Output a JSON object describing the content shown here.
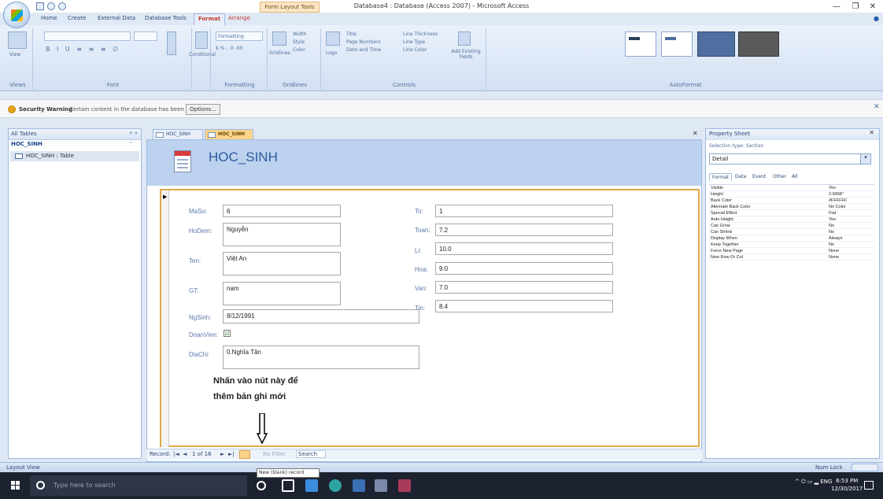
{
  "titlebar": {
    "context_tab": "Form Layout Tools",
    "title": "Database4 : Database (Access 2007) - Microsoft Access",
    "minimize": "—",
    "restore": "❐",
    "close": "✕"
  },
  "ribbon": {
    "tabs": [
      "Home",
      "Create",
      "External Data",
      "Database Tools",
      "Format",
      "Arrange"
    ],
    "active_tab": "Format",
    "groups": {
      "views": "Views",
      "view_button": "View",
      "font": "Font",
      "conditional": "Conditional",
      "formatting": "Formatting",
      "formatting_value": "Formatting",
      "gridlines": "Gridlines",
      "gridlines_btn": "Gridlines",
      "width": "Width",
      "style": "Style",
      "color": "Color",
      "controls": "Controls",
      "logo": "Logo",
      "title": "Title",
      "page_numbers": "Page Numbers",
      "date_time": "Date and Time",
      "line_thickness": "Line Thickness",
      "line_type": "Line Type",
      "line_color": "Line Color",
      "add_existing_fields": "Add Existing Fields",
      "autoformat": "AutoFormat"
    }
  },
  "security": {
    "title": "Security Warning",
    "message": "Certain content in the database has been disabled",
    "options_button": "Options..."
  },
  "navpane": {
    "header": "All Tables",
    "controls": "« »",
    "group": "HOC_SINH",
    "item": "HOC_SINH : Table"
  },
  "document": {
    "tabs": [
      "HOC_SINH",
      "HOC_SINH"
    ],
    "close": "✕"
  },
  "form": {
    "title": "HOC_SINH",
    "fields_left": [
      {
        "label": "MaSo:",
        "value": "6"
      },
      {
        "label": "HoDem:",
        "value": "Nguyễn"
      },
      {
        "label": "Ten:",
        "value": "Việt An"
      },
      {
        "label": "GT:",
        "value": "nam"
      },
      {
        "label": "NgSinh:",
        "value": "8/12/1991"
      },
      {
        "label": "DoanVien:",
        "value": "☑"
      },
      {
        "label": "DiaChi:",
        "value": "0.Nghĩa Tân"
      }
    ],
    "fields_right": [
      {
        "label": "To:",
        "value": "1"
      },
      {
        "label": "Toan:",
        "value": "7.2"
      },
      {
        "label": "Li:",
        "value": "10.0"
      },
      {
        "label": "Hoa:",
        "value": "9.0"
      },
      {
        "label": "Van:",
        "value": "7.0"
      },
      {
        "label": "Tin:",
        "value": "8.4"
      }
    ]
  },
  "annotation": {
    "line1": "Nhấn vào nút này để",
    "line2": "thêm bản ghi mới"
  },
  "record_nav": {
    "record_label": "Record:",
    "first": "|◄",
    "prev": "◄",
    "position": "1 of 16",
    "next": "►",
    "last": "►|",
    "filter": "No Filter",
    "search": "Search",
    "tooltip": "New (blank) record"
  },
  "property_sheet": {
    "title": "Property Sheet",
    "selection_type": "Selection type: Section",
    "selected": "Detail",
    "tabs": [
      "Format",
      "Data",
      "Event",
      "Other",
      "All"
    ],
    "rows": [
      {
        "k": "Visible",
        "v": "Yes"
      },
      {
        "k": "Height",
        "v": "2.9458\""
      },
      {
        "k": "Back Color",
        "v": "#FFFFFF"
      },
      {
        "k": "Alternate Back Color",
        "v": "No Color"
      },
      {
        "k": "Special Effect",
        "v": "Flat"
      },
      {
        "k": "Auto Height",
        "v": "Yes"
      },
      {
        "k": "Can Grow",
        "v": "No"
      },
      {
        "k": "Can Shrink",
        "v": "No"
      },
      {
        "k": "Display When",
        "v": "Always"
      },
      {
        "k": "Keep Together",
        "v": "No"
      },
      {
        "k": "Force New Page",
        "v": "None"
      },
      {
        "k": "New Row Or Col",
        "v": "None"
      }
    ]
  },
  "statusbar": {
    "left": "Layout View",
    "right": "Num Lock"
  },
  "taskbar": {
    "search_placeholder": "Type here to search",
    "tray": "^ ⏻ ▭ ▂ ENG",
    "time": "6:53 PM",
    "date": "12/30/2017"
  }
}
